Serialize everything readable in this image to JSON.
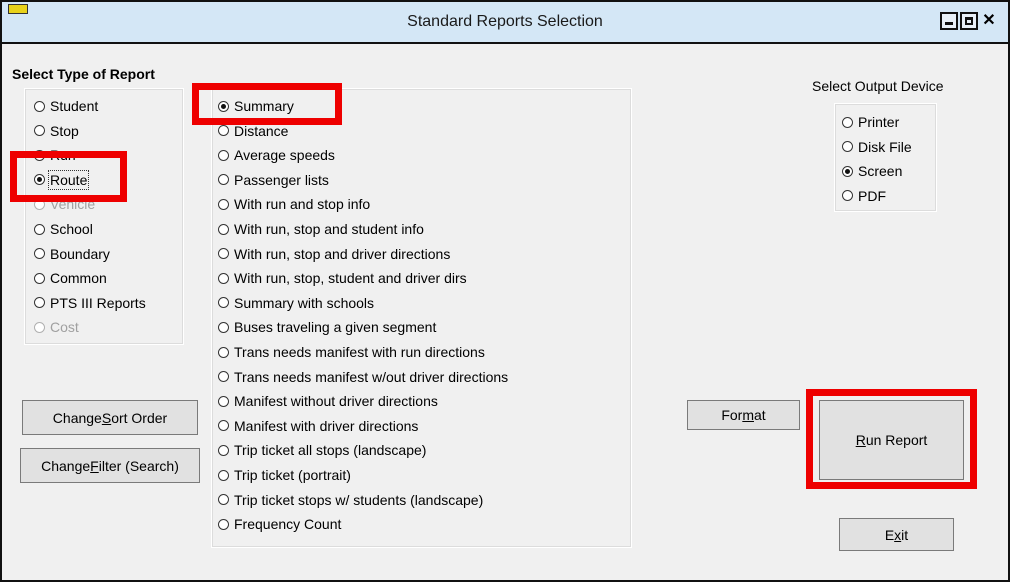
{
  "window": {
    "title": "Standard Reports Selection",
    "close_glyph": "✕"
  },
  "report_type": {
    "heading": "Select Type of Report",
    "options": [
      {
        "label": "Student",
        "checked": false,
        "disabled": false
      },
      {
        "label": "Stop",
        "checked": false,
        "disabled": false
      },
      {
        "label": "Run",
        "checked": false,
        "disabled": false
      },
      {
        "label": "Route",
        "checked": true,
        "disabled": false
      },
      {
        "label": "Vehicle",
        "checked": false,
        "disabled": true
      },
      {
        "label": "School",
        "checked": false,
        "disabled": false
      },
      {
        "label": "Boundary",
        "checked": false,
        "disabled": false
      },
      {
        "label": "Common",
        "checked": false,
        "disabled": false
      },
      {
        "label": "PTS III Reports",
        "checked": false,
        "disabled": false
      },
      {
        "label": "Cost",
        "checked": false,
        "disabled": true
      }
    ]
  },
  "report_list": {
    "options": [
      "Summary",
      "Distance",
      "Average speeds",
      "Passenger lists",
      "With run and stop info",
      "With run, stop and student info",
      "With run, stop and driver directions",
      "With run, stop, student and driver dirs",
      "Summary with schools",
      "Buses traveling a given segment",
      "Trans needs manifest with run directions",
      "Trans needs manifest w/out driver directions",
      "Manifest without driver directions",
      "Manifest with driver directions",
      "Trip ticket all stops (landscape)",
      "Trip ticket (portrait)",
      "Trip ticket stops w/ students (landscape)",
      "Frequency Count"
    ],
    "selected": "Summary"
  },
  "output_device": {
    "heading": "Select Output Device",
    "options": [
      {
        "label": "Printer",
        "checked": false
      },
      {
        "label": "Disk File",
        "checked": false
      },
      {
        "label": "Screen",
        "checked": true
      },
      {
        "label": "PDF",
        "checked": false
      }
    ]
  },
  "buttons": {
    "change_sort_order": {
      "pre": "Change ",
      "u": "S",
      "post": "ort Order"
    },
    "change_filter": {
      "pre": "Change ",
      "u": "F",
      "post": "ilter (Search)"
    },
    "format": {
      "pre": "For",
      "u": "m",
      "post": "at"
    },
    "run_report": {
      "pre": "",
      "u": "R",
      "post": "un Report"
    },
    "exit": {
      "pre": "E",
      "u": "x",
      "post": "it"
    }
  },
  "colors": {
    "highlight": "#ee0000",
    "titlebar": "#d4e7f6"
  }
}
